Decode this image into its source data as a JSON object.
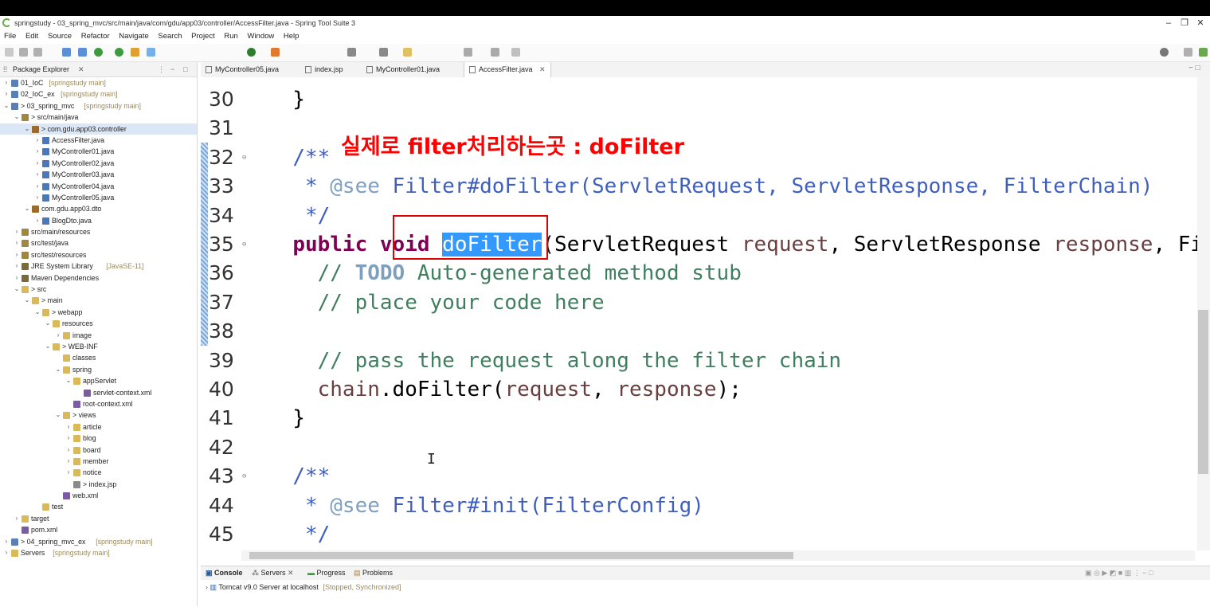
{
  "window": {
    "title": "springstudy - 03_spring_mvc/src/main/java/com/gdu/app03/controller/AccessFilter.java - Spring Tool Suite 3",
    "controls": [
      "–",
      "❐",
      "✕"
    ]
  },
  "menu": [
    "File",
    "Edit",
    "Source",
    "Refactor",
    "Navigate",
    "Search",
    "Project",
    "Run",
    "Window",
    "Help"
  ],
  "package_explorer": {
    "tab_label": "Package Explorer",
    "tree": [
      {
        "label": "01_IoC",
        "sub": "[springstudy main]",
        "depth": 0,
        "arrow": ">",
        "icon": "project"
      },
      {
        "label": "02_IoC_ex",
        "sub": "[springstudy main]",
        "depth": 0,
        "arrow": ">",
        "icon": "project"
      },
      {
        "label": "> 03_spring_mvc",
        "sub": "[springstudy main]",
        "depth": 0,
        "arrow": "v",
        "icon": "project"
      },
      {
        "label": "> src/main/java",
        "sub": "",
        "depth": 1,
        "arrow": "v",
        "icon": "srcfolder"
      },
      {
        "label": "> com.gdu.app03.controller",
        "sub": "",
        "depth": 2,
        "arrow": "v",
        "icon": "package",
        "selected": true
      },
      {
        "label": "AccessFilter.java",
        "sub": "",
        "depth": 3,
        "arrow": ">",
        "icon": "java"
      },
      {
        "label": "MyController01.java",
        "sub": "",
        "depth": 3,
        "arrow": ">",
        "icon": "java"
      },
      {
        "label": "MyController02.java",
        "sub": "",
        "depth": 3,
        "arrow": ">",
        "icon": "java"
      },
      {
        "label": "MyController03.java",
        "sub": "",
        "depth": 3,
        "arrow": ">",
        "icon": "java"
      },
      {
        "label": "MyController04.java",
        "sub": "",
        "depth": 3,
        "arrow": ">",
        "icon": "java"
      },
      {
        "label": "MyController05.java",
        "sub": "",
        "depth": 3,
        "arrow": ">",
        "icon": "java"
      },
      {
        "label": "com.gdu.app03.dto",
        "sub": "",
        "depth": 2,
        "arrow": "v",
        "icon": "package"
      },
      {
        "label": "BlogDto.java",
        "sub": "",
        "depth": 3,
        "arrow": ">",
        "icon": "java"
      },
      {
        "label": "src/main/resources",
        "sub": "",
        "depth": 1,
        "arrow": ">",
        "icon": "srcfolder"
      },
      {
        "label": "src/test/java",
        "sub": "",
        "depth": 1,
        "arrow": ">",
        "icon": "srcfolder"
      },
      {
        "label": "src/test/resources",
        "sub": "",
        "depth": 1,
        "arrow": ">",
        "icon": "srcfolder"
      },
      {
        "label": "JRE System Library",
        "sub": "[JavaSE-11]",
        "depth": 1,
        "arrow": ">",
        "icon": "library"
      },
      {
        "label": "Maven Dependencies",
        "sub": "",
        "depth": 1,
        "arrow": ">",
        "icon": "library"
      },
      {
        "label": "> src",
        "sub": "",
        "depth": 1,
        "arrow": "v",
        "icon": "folder"
      },
      {
        "label": "> main",
        "sub": "",
        "depth": 2,
        "arrow": "v",
        "icon": "folder"
      },
      {
        "label": "> webapp",
        "sub": "",
        "depth": 3,
        "arrow": "v",
        "icon": "folder"
      },
      {
        "label": "resources",
        "sub": "",
        "depth": 4,
        "arrow": "v",
        "icon": "folder"
      },
      {
        "label": "image",
        "sub": "",
        "depth": 5,
        "arrow": ">",
        "icon": "folder"
      },
      {
        "label": "> WEB-INF",
        "sub": "",
        "depth": 4,
        "arrow": "v",
        "icon": "folder"
      },
      {
        "label": "classes",
        "sub": "",
        "depth": 5,
        "arrow": "",
        "icon": "folder"
      },
      {
        "label": "spring",
        "sub": "",
        "depth": 5,
        "arrow": "v",
        "icon": "folder"
      },
      {
        "label": "appServlet",
        "sub": "",
        "depth": 6,
        "arrow": "v",
        "icon": "folder"
      },
      {
        "label": "servlet-context.xml",
        "sub": "",
        "depth": 7,
        "arrow": "",
        "icon": "xml"
      },
      {
        "label": "root-context.xml",
        "sub": "",
        "depth": 6,
        "arrow": "",
        "icon": "xml"
      },
      {
        "label": "> views",
        "sub": "",
        "depth": 5,
        "arrow": "v",
        "icon": "folder"
      },
      {
        "label": "article",
        "sub": "",
        "depth": 6,
        "arrow": ">",
        "icon": "folder"
      },
      {
        "label": "blog",
        "sub": "",
        "depth": 6,
        "arrow": ">",
        "icon": "folder"
      },
      {
        "label": "board",
        "sub": "",
        "depth": 6,
        "arrow": ">",
        "icon": "folder"
      },
      {
        "label": "member",
        "sub": "",
        "depth": 6,
        "arrow": ">",
        "icon": "folder"
      },
      {
        "label": "notice",
        "sub": "",
        "depth": 6,
        "arrow": ">",
        "icon": "folder"
      },
      {
        "label": "> index.jsp",
        "sub": "",
        "depth": 6,
        "arrow": "",
        "icon": "file"
      },
      {
        "label": "web.xml",
        "sub": "",
        "depth": 5,
        "arrow": "",
        "icon": "xml"
      },
      {
        "label": "test",
        "sub": "",
        "depth": 3,
        "arrow": "",
        "icon": "folder"
      },
      {
        "label": "target",
        "sub": "",
        "depth": 1,
        "arrow": ">",
        "icon": "folder"
      },
      {
        "label": "pom.xml",
        "sub": "",
        "depth": 1,
        "arrow": "",
        "icon": "xml"
      },
      {
        "label": "> 04_spring_mvc_ex",
        "sub": "[springstudy main]",
        "depth": 0,
        "arrow": ">",
        "icon": "project"
      },
      {
        "label": "Servers",
        "sub": "[springstudy main]",
        "depth": 0,
        "arrow": ">",
        "icon": "folder"
      }
    ]
  },
  "editor_tabs": [
    {
      "label": "MyController05.java",
      "active": false
    },
    {
      "label": "index.jsp",
      "active": false
    },
    {
      "label": "MyController01.java",
      "active": false
    },
    {
      "label": "AccessFilter.java",
      "active": true
    }
  ],
  "annotation": {
    "text": "실제로 filter처리하는곳 : doFilter",
    "color": "#ff0000"
  },
  "code_lines": [
    {
      "num": "30",
      "fold": "",
      "html": "  }"
    },
    {
      "num": "31",
      "fold": "",
      "html": ""
    },
    {
      "num": "32",
      "fold": "⊖",
      "html": "  <span class=\"cm\">/**</span>"
    },
    {
      "num": "33",
      "fold": "",
      "html": "<span class=\"cm\">   * </span><span class=\"ann\">@see</span><span class=\"cm\"> Filter#doFilter(ServletRequest, ServletResponse, FilterChain)</span>"
    },
    {
      "num": "34",
      "fold": "",
      "html": "<span class=\"cm\">   */</span>"
    },
    {
      "num": "35",
      "fold": "⊖",
      "html": "  <span class=\"kw\">public</span> <span class=\"kw\">void</span> <span class=\"hl\">doFilter</span>(ServletRequest <span class=\"param\">request</span>, ServletResponse <span class=\"param\">response</span>, Fil"
    },
    {
      "num": "36",
      "fold": "",
      "html": "    <span class=\"cmt\">// </span><span class=\"todo\">TODO</span><span class=\"cmt\"> Auto-generated method stub</span>"
    },
    {
      "num": "37",
      "fold": "",
      "html": "    <span class=\"cmt\">// place your code here</span>"
    },
    {
      "num": "38",
      "fold": "",
      "html": ""
    },
    {
      "num": "39",
      "fold": "",
      "html": "    <span class=\"cmt\">// pass the request along the filter chain</span>"
    },
    {
      "num": "40",
      "fold": "",
      "html": "    <span class=\"param\">chain</span>.doFilter(<span class=\"param\">request</span>, <span class=\"param\">response</span>);"
    },
    {
      "num": "41",
      "fold": "",
      "html": "  }"
    },
    {
      "num": "42",
      "fold": "",
      "html": ""
    },
    {
      "num": "43",
      "fold": "⊖",
      "html": "  <span class=\"cm\">/**</span>"
    },
    {
      "num": "44",
      "fold": "",
      "html": "<span class=\"cm\">   * </span><span class=\"ann\">@see</span><span class=\"cm\"> Filter#init(FilterConfig)</span>"
    },
    {
      "num": "45",
      "fold": "",
      "html": "<span class=\"cm\">   */</span>"
    }
  ],
  "bottom_tabs": [
    {
      "label": "Console",
      "active": true
    },
    {
      "label": "Servers",
      "active": false
    },
    {
      "label": "Progress",
      "active": false
    },
    {
      "label": "Problems",
      "active": false
    }
  ],
  "server_entry": {
    "name": "Tomcat v9.0 Server at localhost",
    "status": "[Stopped, Synchronized]"
  },
  "colors": {
    "keyword": "#7f0055",
    "javadoc": "#3f5fbf",
    "comment": "#3f7f5f",
    "selection": "#3399ff",
    "annotation": "#ff0000"
  }
}
